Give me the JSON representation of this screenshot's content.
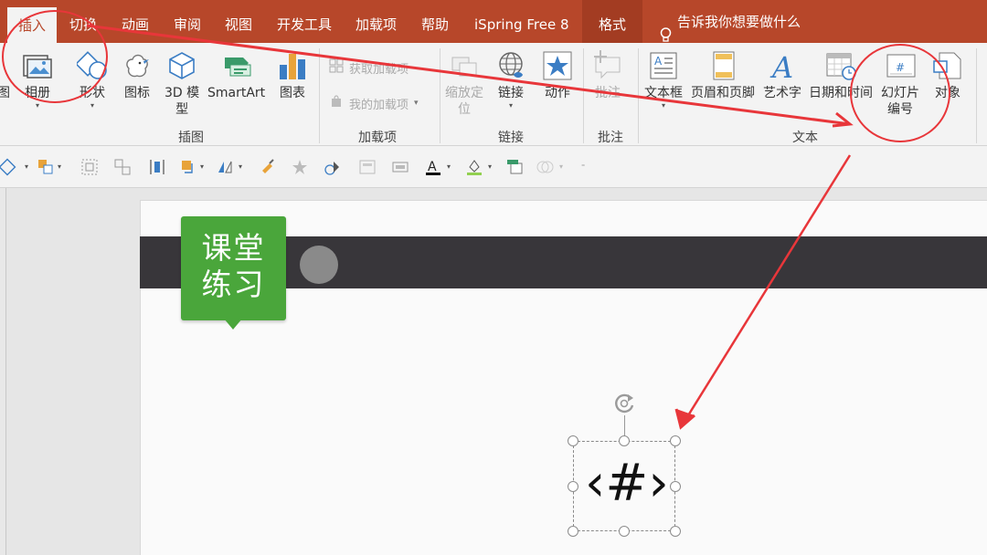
{
  "tabs": [
    "插入",
    "切换",
    "动画",
    "审阅",
    "视图",
    "开发工具",
    "加载项",
    "帮助",
    "iSpring Free 8",
    "格式"
  ],
  "tell_me": "告诉我你想要做什么",
  "ribbon": {
    "images_partial": "图",
    "album": "相册",
    "shapes": "形状",
    "icons": "图标",
    "model3d": "3D 模\n型",
    "smartart": "SmartArt",
    "chart": "图表",
    "get_addins": "获取加载项",
    "my_addins": "我的加载项",
    "zoom_link": "缩放定\n位",
    "link": "链接",
    "action": "动作",
    "comment": "批注",
    "textbox": "文本框",
    "header_footer": "页眉和页脚",
    "wordart": "艺术字",
    "date_time": "日期和时间",
    "slide_number": "幻灯片\n编号",
    "object": "对象",
    "groups": {
      "illustrations": "插图",
      "addins": "加载项",
      "links": "链接",
      "comments": "批注",
      "text": "文本"
    }
  },
  "slide": {
    "badge": "课堂\n练习",
    "slide_number_placeholder": "‹#›"
  },
  "colors": {
    "tab_bar": "#b7472a",
    "ribbon_bg": "#f3f3f3",
    "badge": "#4aa63b",
    "dark_bar": "#38363a",
    "annotation": "#e8363a"
  },
  "icons": [
    "album-icon",
    "shapes-icon",
    "icons-icon",
    "3d-model-icon",
    "smartart-icon",
    "chart-icon",
    "store-icon",
    "my-addins-icon",
    "zoom-icon",
    "link-icon",
    "action-icon",
    "comment-icon",
    "textbox-icon",
    "header-footer-icon",
    "wordart-icon",
    "date-time-icon",
    "slide-number-icon",
    "object-icon",
    "rotate-icon",
    "lightbulb-icon"
  ]
}
